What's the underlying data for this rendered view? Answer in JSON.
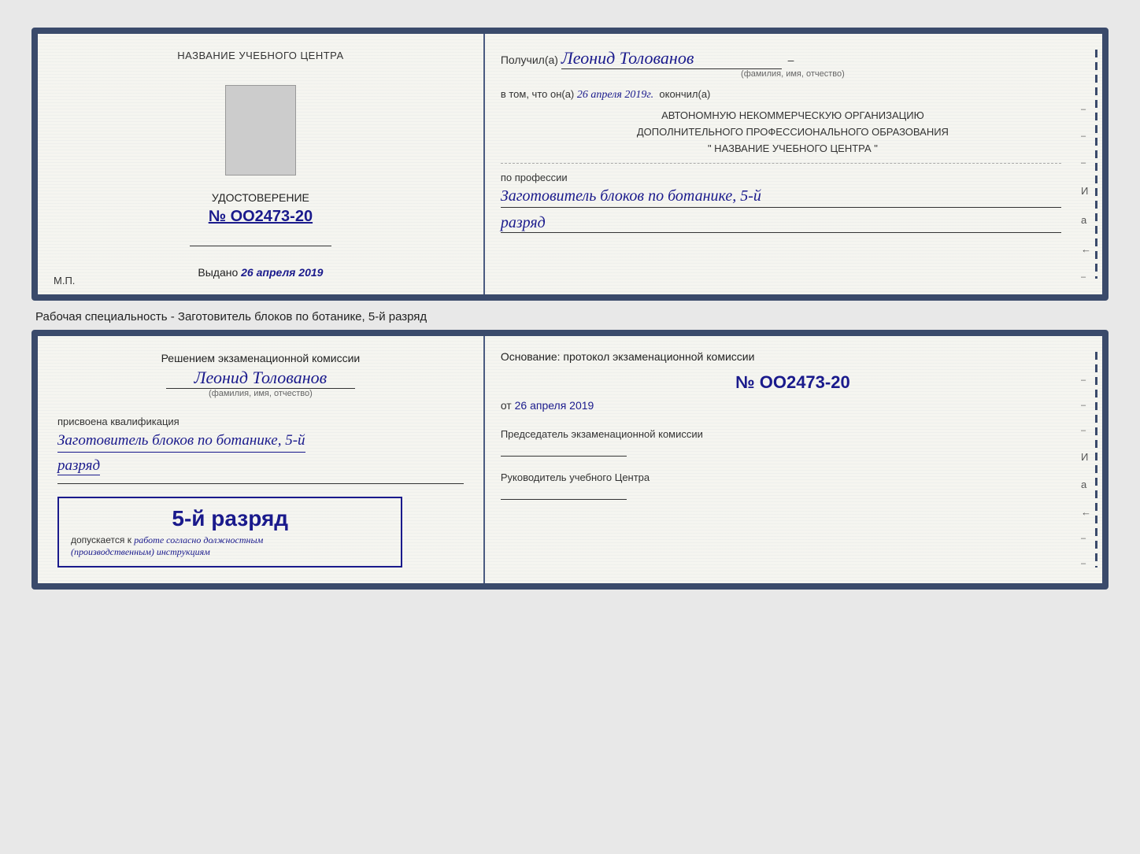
{
  "page": {
    "background": "#e8e8e8"
  },
  "top_document": {
    "left": {
      "heading": "НАЗВАНИЕ УЧЕБНОГО ЦЕНТРА",
      "cert_title": "УДОСТОВЕРЕНИЕ",
      "cert_number": "№ OO2473-20",
      "issued_label": "Выдано",
      "issued_date": "26 апреля 2019",
      "mp_label": "М.П."
    },
    "right": {
      "received_prefix": "Получил(а)",
      "recipient_name": "Леонид Толованов",
      "name_subtitle": "(фамилия, имя, отчество)",
      "in_that_prefix": "в том, что он(а)",
      "completion_date": "26 апреля 2019г.",
      "completed_label": "окончил(а)",
      "org_line1": "АВТОНОМНУЮ НЕКОММЕРЧЕСКУЮ ОРГАНИЗАЦИЮ",
      "org_line2": "ДОПОЛНИТЕЛЬНОГО ПРОФЕССИОНАЛЬНОГО ОБРАЗОВАНИЯ",
      "org_line3": "\"  НАЗВАНИЕ УЧЕБНОГО ЦЕНТРА  \"",
      "profession_label": "по профессии",
      "profession_value": "Заготовитель блоков по ботанике, 5-й",
      "rank_value": "разряд",
      "margin_letter1": "И",
      "margin_letter2": "а",
      "margin_arrow": "←"
    }
  },
  "separator": {
    "text": "Рабочая специальность - Заготовитель блоков по ботанике, 5-й разряд"
  },
  "bottom_document": {
    "left": {
      "decision_text": "Решением экзаменационной комиссии",
      "person_name": "Леонид Толованов",
      "name_subtitle": "(фамилия, имя, отчество)",
      "assigned_label": "присвоена квалификация",
      "qualification_value": "Заготовитель блоков по ботанике, 5-й",
      "rank_value": "разряд",
      "stamp_rank": "5-й разряд",
      "admit_prefix": "допускается к",
      "admit_text": "работе согласно должностным",
      "admit_text2": "(производственным) инструкциям"
    },
    "right": {
      "basis_title": "Основание: протокол экзаменационной комиссии",
      "protocol_number": "№  OO2473-20",
      "date_prefix": "от",
      "date_value": "26 апреля 2019",
      "chairman_title": "Председатель экзаменационной комиссии",
      "director_title": "Руководитель учебного Центра",
      "margin_letter1": "И",
      "margin_letter2": "а",
      "margin_arrow": "←"
    }
  }
}
